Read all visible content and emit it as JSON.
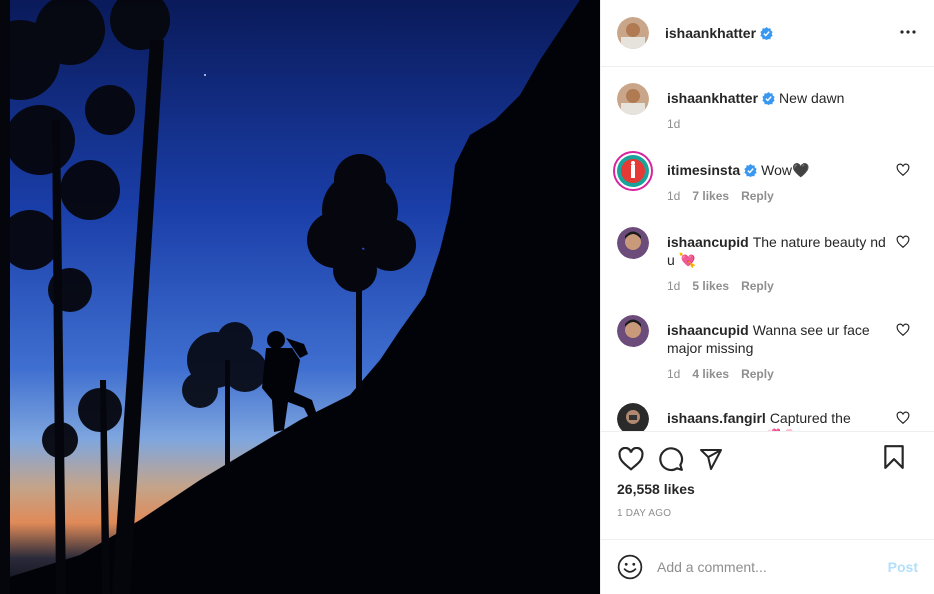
{
  "post": {
    "author": "ishaankhatter",
    "caption": "New dawn",
    "caption_time": "1d",
    "likes": "26,558 likes",
    "posted": "1 DAY AGO"
  },
  "comments": [
    {
      "user": "itimesinsta",
      "verified": true,
      "text": "Wow🖤",
      "time": "1d",
      "likes": "7 likes",
      "reply": "Reply"
    },
    {
      "user": "ishaancupid",
      "verified": false,
      "text": "The nature beauty nd u 💘",
      "time": "1d",
      "likes": "5 likes",
      "reply": "Reply"
    },
    {
      "user": "ishaancupid",
      "verified": false,
      "text": "Wanna see ur face major missing",
      "time": "1d",
      "likes": "4 likes",
      "reply": "Reply"
    },
    {
      "user": "ishaans.fangirl",
      "verified": false,
      "text": "Captured the beauty so well!!💞🌸📷",
      "time": "",
      "likes": "",
      "reply": ""
    }
  ],
  "comment_box": {
    "placeholder": "Add a comment...",
    "post_label": "Post"
  },
  "icons": {
    "verified": "verified-badge-icon",
    "more": "more-options-icon",
    "like": "heart-icon",
    "comment": "comment-icon",
    "share": "send-icon",
    "save": "bookmark-icon",
    "emoji": "emoji-icon"
  },
  "colors": {
    "verified": "#3897f0",
    "post_disabled": "#b2dffc",
    "muted": "#8e8e8e"
  }
}
